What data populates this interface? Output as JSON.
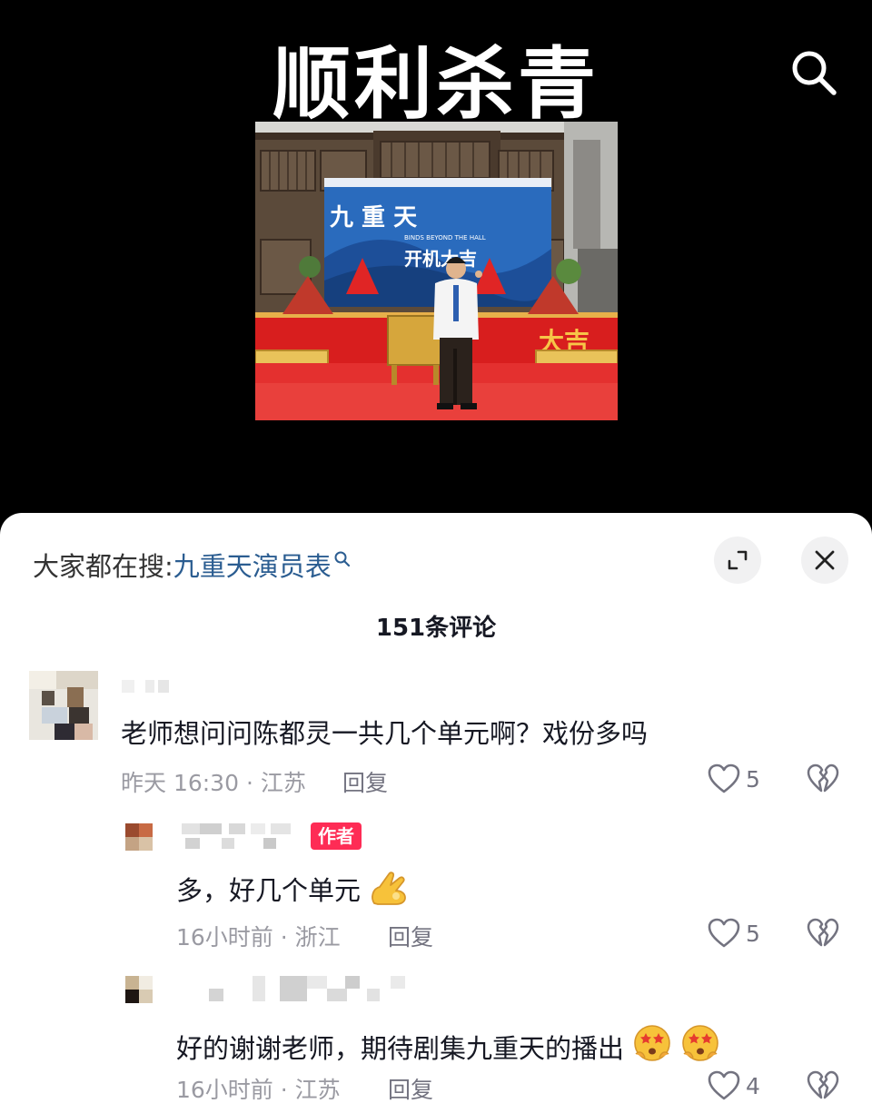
{
  "video": {
    "title": "顺利杀青",
    "photo": {
      "poster_title": "九 重 天",
      "poster_subtitle": "开机大吉",
      "poster_en": "BINDS BEYOND THE HALL",
      "banner_right": "大吉"
    }
  },
  "sheet": {
    "search_prefix": "大家都在搜:",
    "search_term": "九重天演员表",
    "comment_count": "151条评论",
    "comments": [
      {
        "text": "老师想问问陈都灵一共几个单元啊？戏份多吗",
        "meta": "昨天 16:30 · 江苏",
        "reply_label": "回复",
        "likes": "5"
      },
      {
        "author_badge": "作者",
        "text": "多，好几个单元",
        "emoji_icon": "ok-hand-icon",
        "meta": "16小时前 · 浙江",
        "reply_label": "回复",
        "likes": "5"
      },
      {
        "text": "好的谢谢老师，期待剧集九重天的播出",
        "emoji_icon": "starry-eyed-face-icon",
        "meta": "16小时前 · 江苏",
        "reply_label": "回复",
        "likes": "4"
      }
    ]
  },
  "colors": {
    "link": "#2b5d91",
    "author_badge": "#fe2c55",
    "meta": "#9a9aa2",
    "sheet_bg": "#ffffff"
  }
}
